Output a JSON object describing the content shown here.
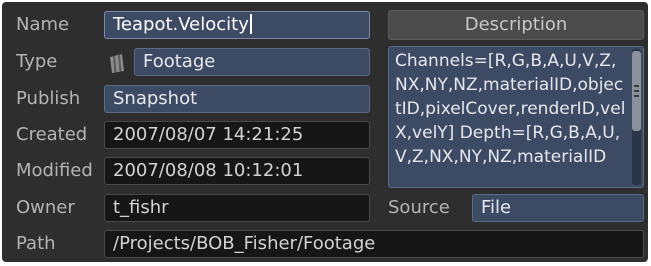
{
  "fields": {
    "name": {
      "label": "Name",
      "value": "Teapot.Velocity"
    },
    "type": {
      "label": "Type",
      "value": "Footage"
    },
    "publish": {
      "label": "Publish",
      "value": "Snapshot"
    },
    "created": {
      "label": "Created",
      "value": "2007/08/07 14:21:25"
    },
    "modified": {
      "label": "Modified",
      "value": "2007/08/08 10:12:01"
    },
    "owner": {
      "label": "Owner",
      "value": "t_fishr"
    },
    "source": {
      "label": "Source",
      "value": "File"
    },
    "path": {
      "label": "Path",
      "value": "/Projects/BOB_Fisher/Footage"
    }
  },
  "description": {
    "header": "Description",
    "text": "Channels=[R,G,B,A,U,V,Z,NX,NY,NZ,materialID,objectID,pixelCover,renderID,velX,velY] Depth=[R,G,B,A,U,V,Z,NX,NY,NZ,materialID"
  },
  "icons": {
    "type_icon": "footage-icon"
  },
  "colors": {
    "panel_bg": "#2e2e2e",
    "field_dark": "#161616",
    "field_blue": "#3c4a63",
    "label_text": "#b4b4b4"
  }
}
